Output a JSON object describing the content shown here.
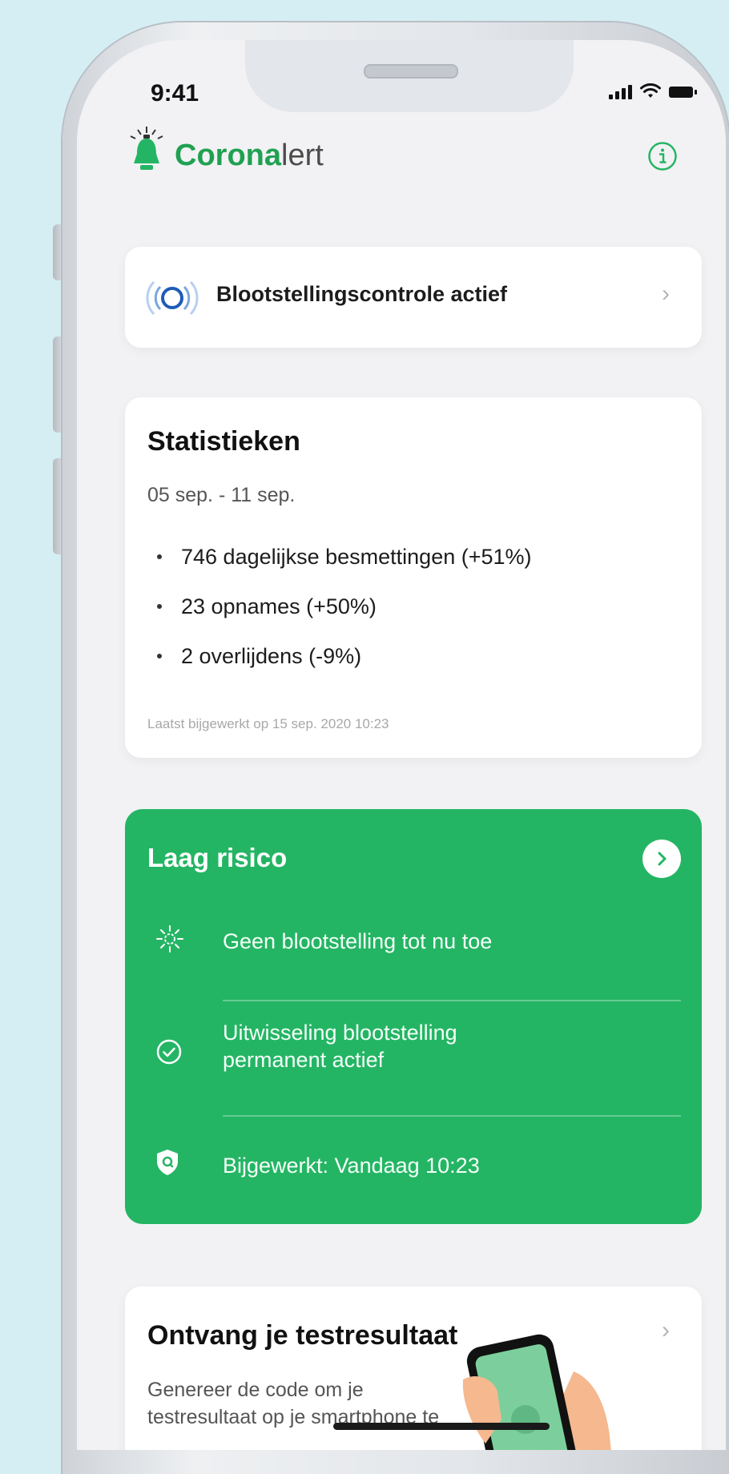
{
  "status_bar": {
    "time": "9:41"
  },
  "header": {
    "app_name_bold": "Corona",
    "app_name_light": "lert",
    "brand_color": "#20a152"
  },
  "exposure": {
    "label": "Blootstellingscontrole actief",
    "icon": "radar-icon"
  },
  "statistics": {
    "title": "Statistieken",
    "period": "05 sep. - 11 sep.",
    "items": [
      "746 dagelijkse besmettingen (+51%)",
      "23 opnames (+50%)",
      "2 overlijdens (-9%)"
    ],
    "updated": "Laatst bijgewerkt op 15 sep. 2020 10:23"
  },
  "risk": {
    "title": "Laag risico",
    "color": "#24b564",
    "rows": [
      {
        "icon": "virus-icon",
        "text": "Geen blootstelling tot nu toe"
      },
      {
        "icon": "check-circle-icon",
        "text_line1": "Uitwisseling blootstelling",
        "text_line2": "permanent actief"
      },
      {
        "icon": "shield-icon",
        "text": "Bijgewerkt: Vandaag 10:23"
      }
    ]
  },
  "test_result": {
    "title": "Ontvang je testresultaat",
    "description_line1": "Genereer de code om je",
    "description_line2": "testresultaat op je smartphone te"
  }
}
